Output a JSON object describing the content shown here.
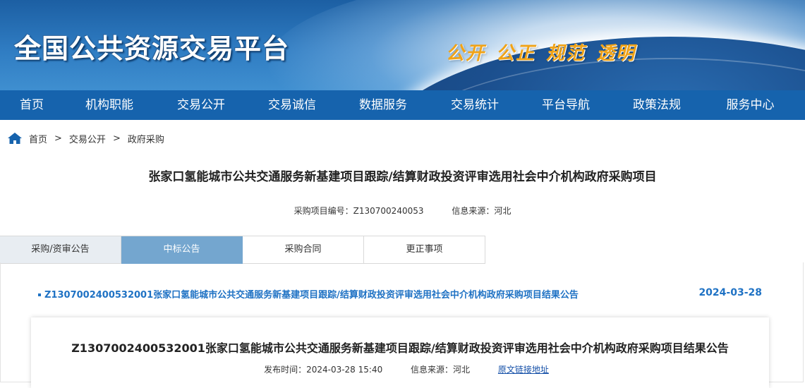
{
  "header": {
    "site_title": "全国公共资源交易平台",
    "slogan": "公开  公正  规范  透明"
  },
  "nav": [
    "首页",
    "机构职能",
    "交易公开",
    "交易诚信",
    "数据服务",
    "交易统计",
    "平台导航",
    "政策法规",
    "服务中心"
  ],
  "breadcrumb": {
    "items": [
      "首页",
      "交易公开",
      "政府采购"
    ],
    "separator": ">"
  },
  "page": {
    "title": "张家口氢能城市公共交通服务新基建项目跟踪/结算财政投资评审选用社会中介机构政府采购项目",
    "project_no": "采购项目编号：Z130700240053",
    "source": "信息来源：河北"
  },
  "tabs": [
    "采购/资审公告",
    "中标公告",
    "采购合同",
    "更正事项"
  ],
  "active_tab": "中标公告",
  "result_list": [
    {
      "title": "Z1307002400532001张家口氢能城市公共交通服务新基建项目跟踪/结算财政投资评审选用社会中介机构政府采购项目结果公告",
      "date": "2024-03-28"
    }
  ],
  "detail": {
    "title": "Z1307002400532001张家口氢能城市公共交通服务新基建项目跟踪/结算财政投资评审选用社会中介机构政府采购项目结果公告",
    "publish_time": "发布时间：2024-03-28 15:40",
    "source": "信息来源：河北",
    "original_link": "原文链接地址"
  },
  "colors": {
    "nav_bg": "#1663ad",
    "active_tab": "#74a6cf",
    "link": "#1f72c4",
    "slogan": "#f0a318"
  }
}
